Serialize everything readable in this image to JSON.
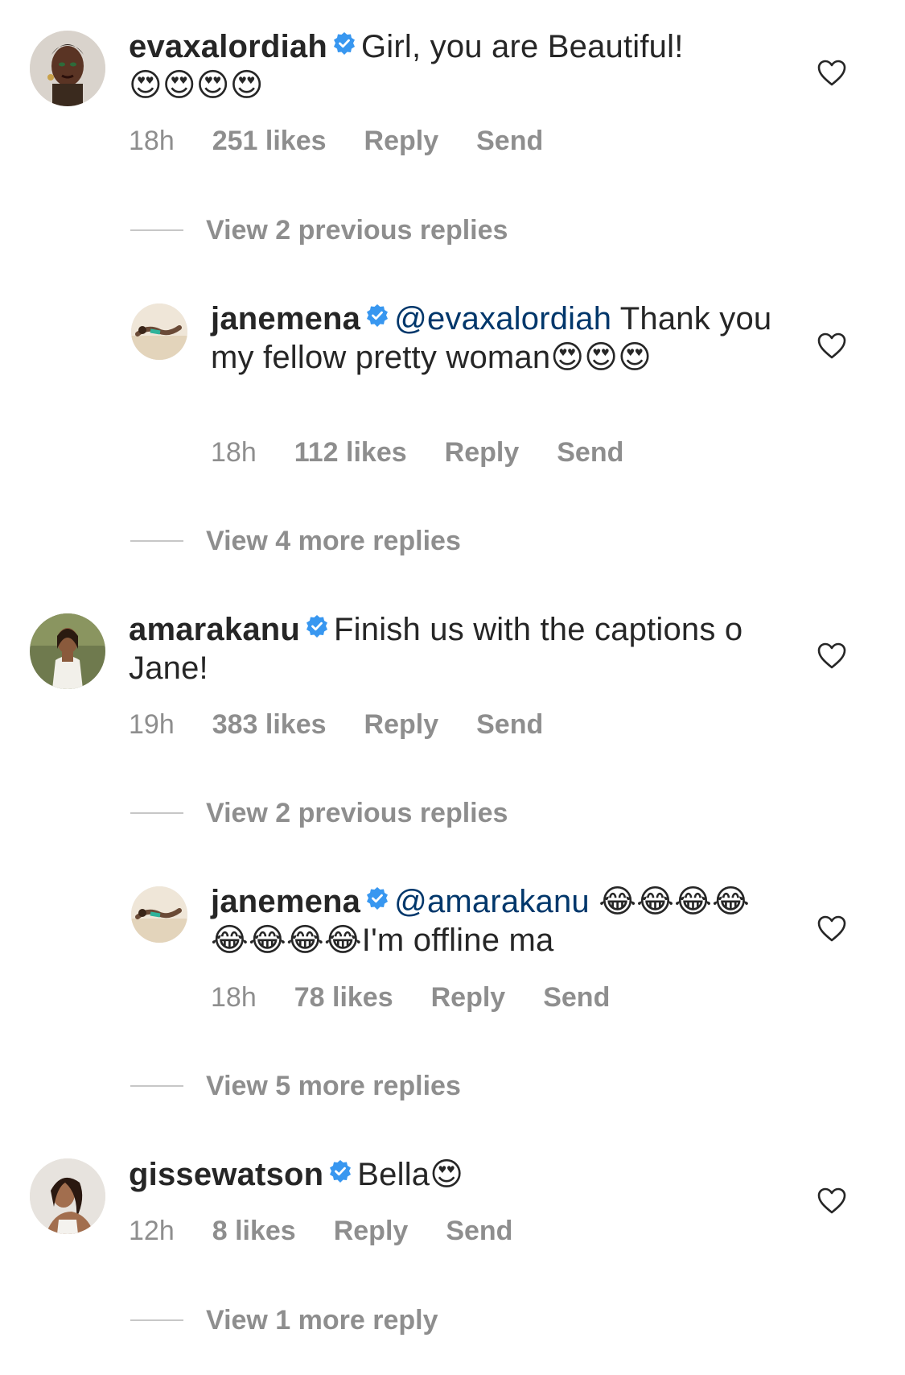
{
  "comments": [
    {
      "username": "evaxalordiah",
      "text": "Girl, you are Beautiful!",
      "emojis": "😍😍😍😍",
      "time": "18h",
      "likes": "251 likes",
      "reply_label": "Reply",
      "send_label": "Send",
      "view_replies": "View 2 previous replies",
      "reply": {
        "username": "janemena",
        "mention": "@evaxalordiah",
        "text": " Thank you my fellow pretty woman",
        "emojis": "😍😍😍",
        "time": "18h",
        "likes": "112 likes",
        "reply_label": "Reply",
        "send_label": "Send"
      },
      "more_replies": "View 4 more replies"
    },
    {
      "username": "amarakanu",
      "text": "Finish us with the captions o Jane!",
      "time": "19h",
      "likes": "383 likes",
      "reply_label": "Reply",
      "send_label": "Send",
      "view_replies": "View 2 previous replies",
      "reply": {
        "username": "janemena",
        "mention": "@amarakanu",
        "emojis_before": "😂😂😂😂😂😂😂😂",
        "text": "I'm offline ma",
        "time": "18h",
        "likes": "78 likes",
        "reply_label": "Reply",
        "send_label": "Send"
      },
      "more_replies": "View 5 more replies"
    },
    {
      "username": "gissewatson",
      "text": "Bella",
      "emojis": "😍",
      "time": "12h",
      "likes": "8 likes",
      "reply_label": "Reply",
      "send_label": "Send",
      "more_replies": "View 1 more reply"
    }
  ],
  "colors": {
    "text": "#262626",
    "meta": "#8e8e8e",
    "mention": "#00376b",
    "verified": "#3897f0"
  },
  "icons": {
    "verified": "verified-badge-icon",
    "heart": "heart-outline-icon"
  }
}
